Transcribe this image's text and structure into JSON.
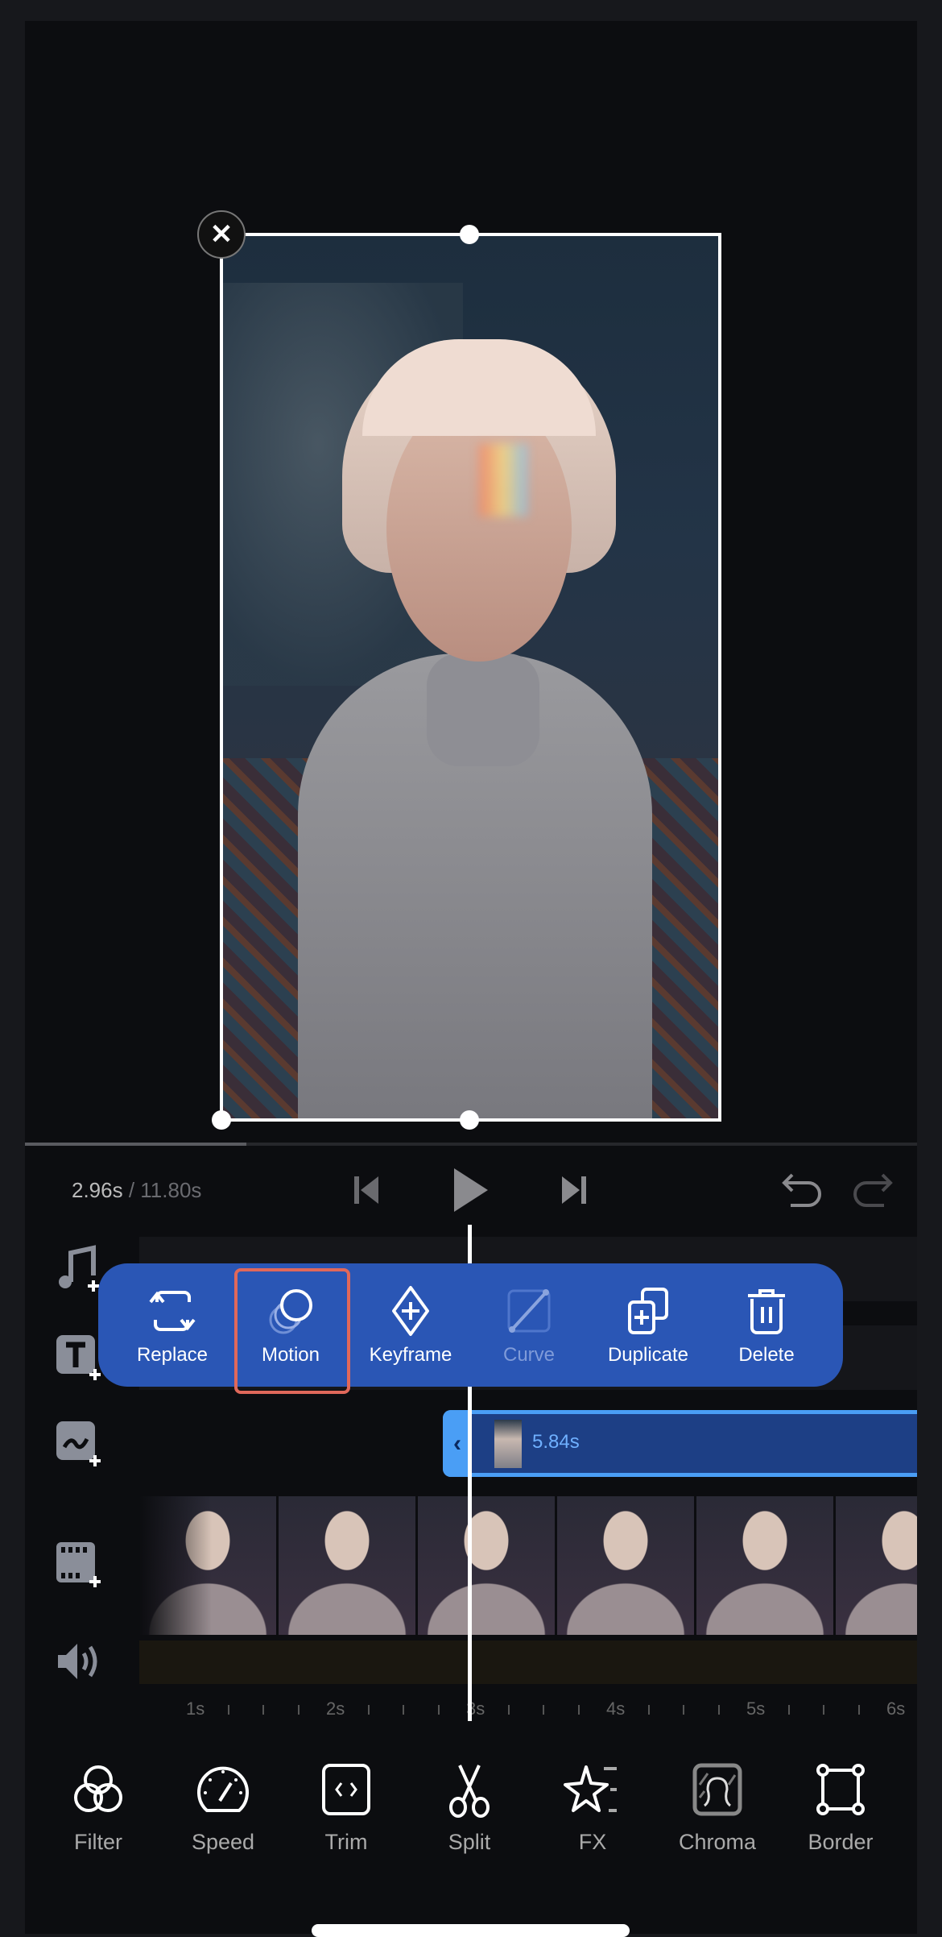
{
  "player": {
    "current_time": "2.96s",
    "separator": " / ",
    "total_time": "11.80s",
    "progress_fraction": 0.2508
  },
  "controls": [
    "skip-back",
    "play",
    "skip-forward",
    "undo",
    "redo"
  ],
  "popup": {
    "items": [
      {
        "label": "Replace",
        "icon": "replace-icon",
        "enabled": true
      },
      {
        "label": "Motion",
        "icon": "motion-icon",
        "enabled": true,
        "highlighted": true
      },
      {
        "label": "Keyframe",
        "icon": "keyframe-icon",
        "enabled": true
      },
      {
        "label": "Curve",
        "icon": "curve-icon",
        "enabled": false
      },
      {
        "label": "Duplicate",
        "icon": "duplicate-icon",
        "enabled": true
      },
      {
        "label": "Delete",
        "icon": "delete-icon",
        "enabled": true
      }
    ]
  },
  "tracks": {
    "icons": [
      "add-music-icon",
      "add-text-icon",
      "add-sticker-icon",
      "add-video-icon",
      "volume-icon"
    ]
  },
  "sticker_clip": {
    "duration": "5.84s"
  },
  "ruler": {
    "labels": [
      "1s",
      "2s",
      "3s",
      "4s",
      "5s",
      "6s"
    ]
  },
  "tools": [
    {
      "label": "Filter",
      "icon": "filter-icon"
    },
    {
      "label": "Speed",
      "icon": "speed-icon"
    },
    {
      "label": "Trim",
      "icon": "trim-icon"
    },
    {
      "label": "Split",
      "icon": "scissors-icon"
    },
    {
      "label": "FX",
      "icon": "fx-star-icon"
    },
    {
      "label": "Chroma",
      "icon": "chroma-icon"
    },
    {
      "label": "Border",
      "icon": "border-icon"
    }
  ],
  "colors": {
    "popup": "#2a56b5",
    "highlight": "#e0685a",
    "clip_border": "#4a9ef5",
    "clip_fill": "#1d3f85"
  }
}
